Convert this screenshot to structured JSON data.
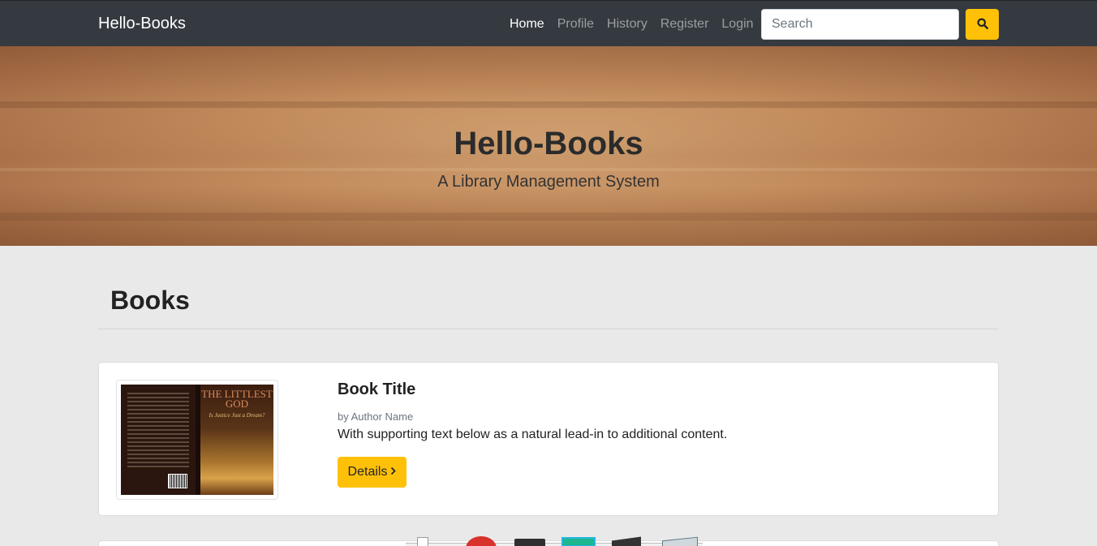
{
  "navbar": {
    "brand": "Hello-Books",
    "links": [
      {
        "label": "Home",
        "active": true
      },
      {
        "label": "Profile",
        "active": false
      },
      {
        "label": "History",
        "active": false
      },
      {
        "label": "Register",
        "active": false
      },
      {
        "label": "Login",
        "active": false
      }
    ],
    "search_placeholder": "Search",
    "search_icon": "search-icon"
  },
  "hero": {
    "title": "Hello-Books",
    "subtitle": "A Library Management System"
  },
  "section": {
    "title": "Books"
  },
  "books": [
    {
      "title": "Book Title",
      "author": "by Author Name",
      "description": "With supporting text below as a natural lead-in to additional content.",
      "button_label": "Details",
      "button_icon": "chevron-right-icon",
      "cover": {
        "title": "THE LITTLEST GOD",
        "subtitle": "Is Justice Just a Dream?"
      }
    }
  ],
  "colors": {
    "navbar": "#343a40",
    "accent": "#ffc107",
    "background": "#e9e9e9"
  }
}
